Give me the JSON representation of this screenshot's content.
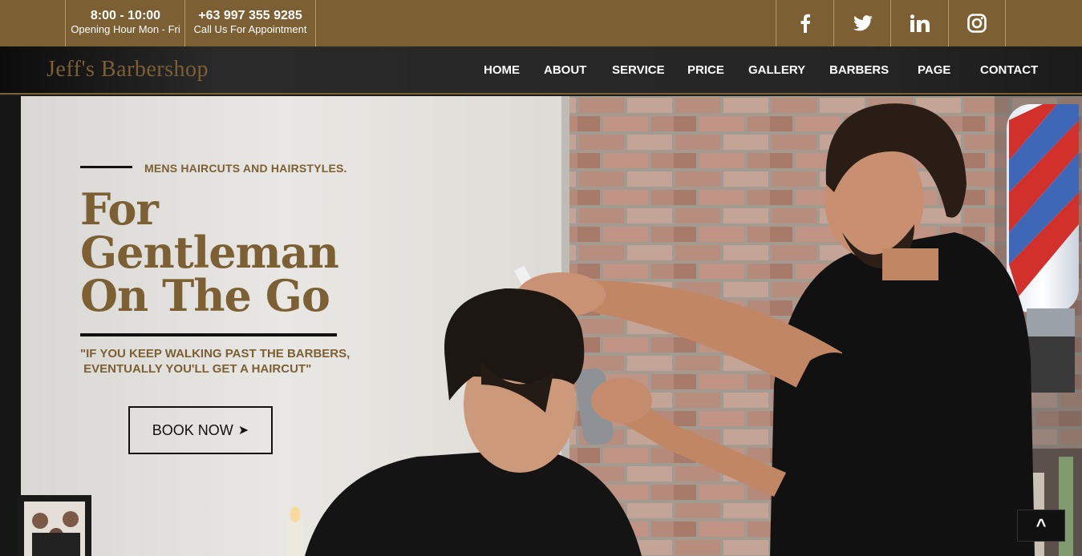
{
  "topbar": {
    "hours": {
      "time": "8:00 - 10:00",
      "label": "Opening Hour Mon - Fri"
    },
    "phone": {
      "number": "+63 997 355 9285",
      "label": "Call Us For Appointment"
    },
    "social": [
      {
        "name": "facebook",
        "glyph": "f"
      },
      {
        "name": "twitter",
        "glyph": "bird"
      },
      {
        "name": "linkedin",
        "glyph": "in"
      },
      {
        "name": "instagram",
        "glyph": "camera"
      }
    ]
  },
  "brand": {
    "name": "Jeff's Barbershop"
  },
  "nav": {
    "items": [
      "HOME",
      "ABOUT",
      "SERVICE",
      "PRICE",
      "GALLERY",
      "BARBERS",
      "PAGE",
      "CONTACT"
    ]
  },
  "hero": {
    "kicker": "MENS HAIRCUTS AND HAIRSTYLES.",
    "headline": [
      "For",
      "Gentleman",
      "On The Go"
    ],
    "quote": "\"IF YOU KEEP WALKING PAST THE BARBERS,\n EVENTUALLY YOU'LL GET A HAIRCUT\"",
    "cta_label": "BOOK NOW",
    "cta_arrow": "➤"
  },
  "back_to_top": {
    "glyph": "^"
  },
  "colors": {
    "accent": "#7c5f33",
    "dark": "#111111",
    "nav_bg": "#252525"
  }
}
